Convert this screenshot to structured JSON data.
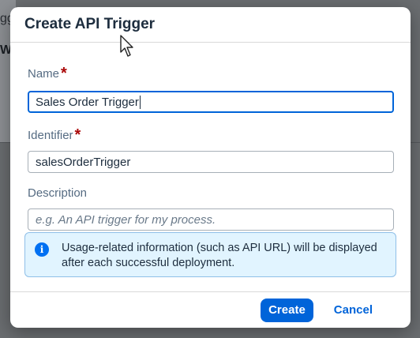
{
  "background": {
    "fragment_top": "gg",
    "fragment_mid": "W"
  },
  "dialog": {
    "title": "Create API Trigger",
    "name_label": "Name",
    "name_required": "*",
    "name_value": "Sales Order Trigger",
    "identifier_label": "Identifier",
    "identifier_required": "*",
    "identifier_value": "salesOrderTrigger",
    "description_label": "Description",
    "description_placeholder": "e.g. An API trigger for my process.",
    "info_text": "Usage-related information (such as API URL) will be displayed after each successful deployment.",
    "create_label": "Create",
    "cancel_label": "Cancel"
  },
  "icons": {
    "info": "info-icon",
    "cursor": "mouse-pointer-icon"
  },
  "colors": {
    "primary": "#0064d9",
    "required": "#aa0808",
    "info_bg": "#e1f4ff"
  }
}
